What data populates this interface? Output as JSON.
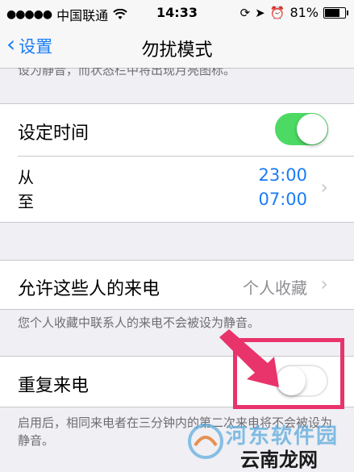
{
  "status_bar": {
    "signal": "●●●●●",
    "carrier": "中国联通",
    "wifi_icon": "wifi-icon",
    "time": "14:33",
    "battery_percent": "81%",
    "battery_level": 0.81
  },
  "nav": {
    "back_label": "设置",
    "title": "勿扰模式"
  },
  "cut_text": "设为静音，而状态栏中将出现月亮图标。",
  "schedule": {
    "label": "设定时间",
    "toggle_on": true,
    "from_label": "从",
    "to_label": "至",
    "from_time": "23:00",
    "to_time": "07:00"
  },
  "allow_calls": {
    "label": "允许这些人的来电",
    "value": "个人收藏",
    "footnote": "您个人收藏中联系人的来电不会被设为静音。"
  },
  "repeated_calls": {
    "label": "重复来电",
    "toggle_on": false,
    "footnote": "启用后，相同来电者在三分钟内的第二次来电将不会被设为静音。"
  },
  "watermark": {
    "top": "河东软件园",
    "bottom": "云南龙网"
  },
  "colors": {
    "accent": "#1a7cf5",
    "toggle_on": "#4cd964",
    "annotation": "#e8336b"
  }
}
